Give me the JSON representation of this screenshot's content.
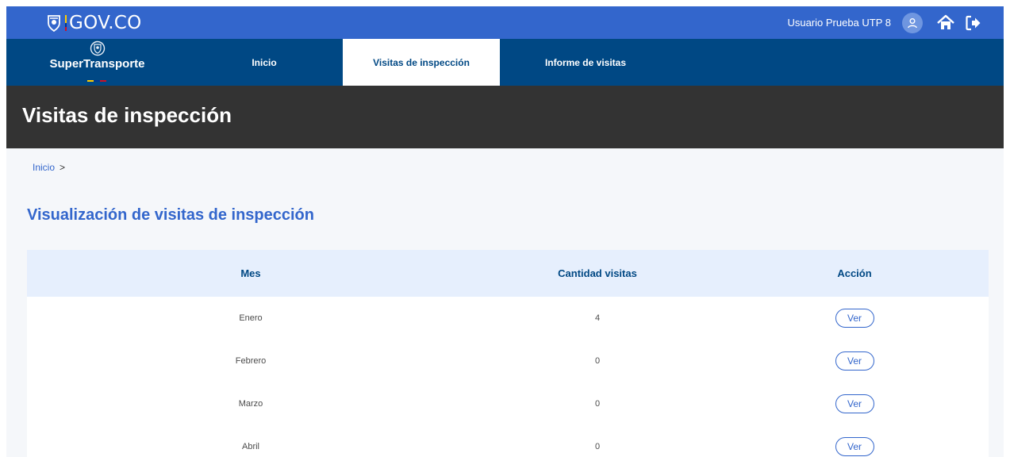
{
  "gov": {
    "logo_text": "GOV.CO"
  },
  "user": {
    "name": "Usuario Prueba UTP 8"
  },
  "brand": {
    "name": "SuperTransporte"
  },
  "nav": {
    "items": [
      {
        "label": "Inicio"
      },
      {
        "label": "Visitas de inspección",
        "active": true
      },
      {
        "label": "Informe de visitas"
      }
    ]
  },
  "page": {
    "title": "Visitas de inspección"
  },
  "breadcrumb": {
    "home": "Inicio",
    "separator": ">"
  },
  "section": {
    "title": "Visualización de visitas de inspección"
  },
  "table": {
    "headers": {
      "month": "Mes",
      "count": "Cantidad visitas",
      "action": "Acción"
    },
    "rows": [
      {
        "month": "Enero",
        "count": "4",
        "action": "Ver"
      },
      {
        "month": "Febrero",
        "count": "0",
        "action": "Ver"
      },
      {
        "month": "Marzo",
        "count": "0",
        "action": "Ver"
      },
      {
        "month": "Abril",
        "count": "0",
        "action": "Ver"
      }
    ]
  },
  "colors": {
    "gov_blue": "#3366cc",
    "nav_blue": "#004884",
    "header_dark": "#333333",
    "table_head": "#e6effd"
  },
  "icons": [
    "colombia-shield-icon",
    "user-icon",
    "home-icon",
    "logout-icon"
  ]
}
